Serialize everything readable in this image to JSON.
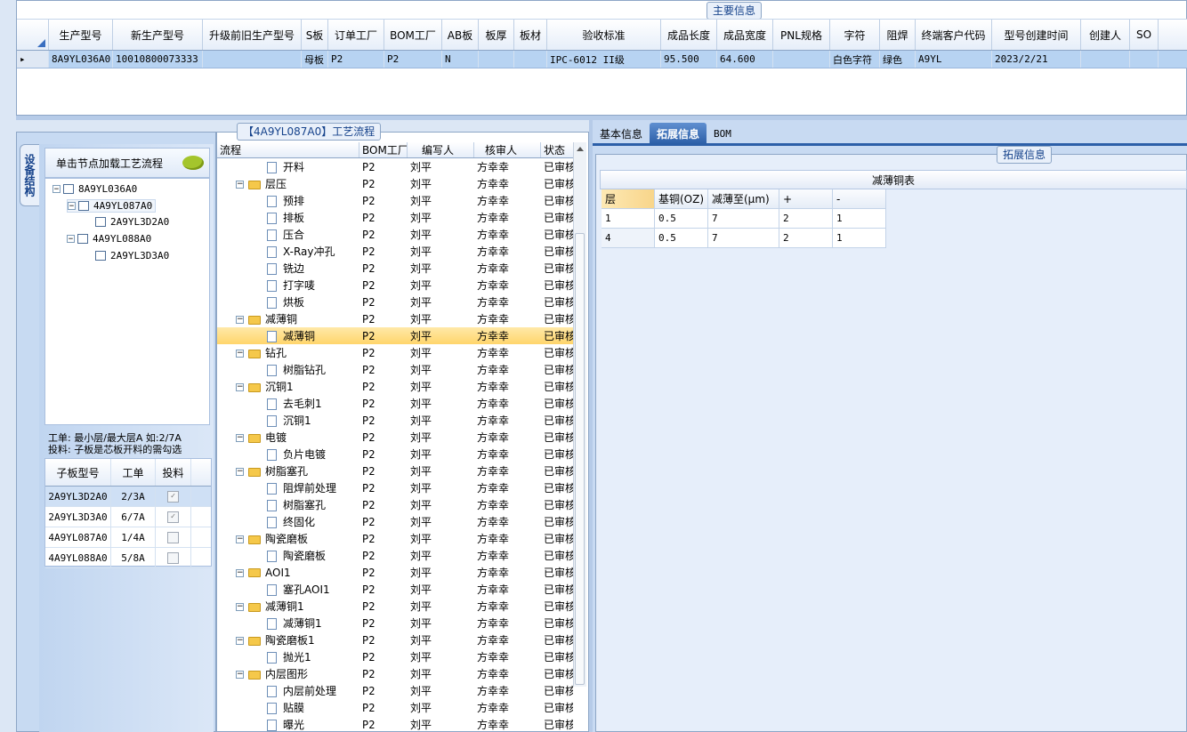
{
  "main_group_title": "主要信息",
  "main_grid": {
    "columns": [
      "生产型号",
      "新生产型号",
      "升级前旧生产型号",
      "S板",
      "订单工厂",
      "BOM工厂",
      "AB板",
      "板厚",
      "板材",
      "验收标准",
      "成品长度",
      "成品宽度",
      "PNL规格",
      "字符",
      "阻焊",
      "终端客户代码",
      "型号创建时间",
      "创建人",
      "SO"
    ],
    "row": [
      "8A9YL036A0",
      "10010800073333",
      "",
      "母板",
      "P2",
      "P2",
      "N",
      "",
      "",
      "IPC-6012 II级",
      "95.500",
      "64.600",
      "",
      "白色字符",
      "绿色",
      "A9YL",
      "2023/2/21",
      "",
      ""
    ]
  },
  "side_tab_label": "设备结构",
  "hint_text": "单击节点加载工艺流程",
  "tree": [
    {
      "label": "8A9YL036A0",
      "level": 0
    },
    {
      "label": "4A9YL087A0",
      "level": 1
    },
    {
      "label": "2A9YL3D2A0",
      "level": 2
    },
    {
      "label": "4A9YL088A0",
      "level": 1
    },
    {
      "label": "2A9YL3D3A0",
      "level": 2
    }
  ],
  "notes": {
    "line1": "工单: 最小层/最大层A 如:2/7A",
    "line2": "投料: 子板是芯板开料的需勾选"
  },
  "sub_grid": {
    "headers": [
      "子板型号",
      "工单",
      "投料"
    ],
    "rows": [
      {
        "model": "2A9YL3D2A0",
        "order": "2/3A",
        "checked": true
      },
      {
        "model": "2A9YL3D3A0",
        "order": "6/7A",
        "checked": true
      },
      {
        "model": "4A9YL087A0",
        "order": "1/4A",
        "checked": false
      },
      {
        "model": "4A9YL088A0",
        "order": "5/8A",
        "checked": false
      }
    ]
  },
  "process_title": "【4A9YL087A0】工艺流程",
  "process_headers": [
    "流程",
    "BOM工厂",
    "编写人",
    "核审人",
    "状态"
  ],
  "process_rows": [
    {
      "name": "开料",
      "type": "doc",
      "bom": "P2",
      "writer": "刘平",
      "reviewer": "方幸幸",
      "status": "已审核"
    },
    {
      "name": "层压",
      "type": "folder",
      "bom": "P2",
      "writer": "刘平",
      "reviewer": "方幸幸",
      "status": "已审核"
    },
    {
      "name": "预排",
      "type": "doc",
      "bom": "P2",
      "writer": "刘平",
      "reviewer": "方幸幸",
      "status": "已审核"
    },
    {
      "name": "排板",
      "type": "doc",
      "bom": "P2",
      "writer": "刘平",
      "reviewer": "方幸幸",
      "status": "已审核"
    },
    {
      "name": "压合",
      "type": "doc",
      "bom": "P2",
      "writer": "刘平",
      "reviewer": "方幸幸",
      "status": "已审核"
    },
    {
      "name": "X-Ray冲孔",
      "type": "doc",
      "bom": "P2",
      "writer": "刘平",
      "reviewer": "方幸幸",
      "status": "已审核"
    },
    {
      "name": "铣边",
      "type": "doc",
      "bom": "P2",
      "writer": "刘平",
      "reviewer": "方幸幸",
      "status": "已审核"
    },
    {
      "name": "打字唛",
      "type": "doc",
      "bom": "P2",
      "writer": "刘平",
      "reviewer": "方幸幸",
      "status": "已审核"
    },
    {
      "name": "烘板",
      "type": "doc",
      "bom": "P2",
      "writer": "刘平",
      "reviewer": "方幸幸",
      "status": "已审核"
    },
    {
      "name": "减薄铜",
      "type": "folder",
      "bom": "P2",
      "writer": "刘平",
      "reviewer": "方幸幸",
      "status": "已审核"
    },
    {
      "name": "减薄铜",
      "type": "doc",
      "bom": "P2",
      "writer": "刘平",
      "reviewer": "方幸幸",
      "status": "已审核",
      "selected": true
    },
    {
      "name": "钻孔",
      "type": "folder",
      "bom": "P2",
      "writer": "刘平",
      "reviewer": "方幸幸",
      "status": "已审核"
    },
    {
      "name": "树脂钻孔",
      "type": "doc",
      "bom": "P2",
      "writer": "刘平",
      "reviewer": "方幸幸",
      "status": "已审核"
    },
    {
      "name": "沉铜1",
      "type": "folder",
      "bom": "P2",
      "writer": "刘平",
      "reviewer": "方幸幸",
      "status": "已审核"
    },
    {
      "name": "去毛刺1",
      "type": "doc",
      "bom": "P2",
      "writer": "刘平",
      "reviewer": "方幸幸",
      "status": "已审核"
    },
    {
      "name": "沉铜1",
      "type": "doc",
      "bom": "P2",
      "writer": "刘平",
      "reviewer": "方幸幸",
      "status": "已审核"
    },
    {
      "name": "电镀",
      "type": "folder",
      "bom": "P2",
      "writer": "刘平",
      "reviewer": "方幸幸",
      "status": "已审核"
    },
    {
      "name": "负片电镀",
      "type": "doc",
      "bom": "P2",
      "writer": "刘平",
      "reviewer": "方幸幸",
      "status": "已审核"
    },
    {
      "name": "树脂塞孔",
      "type": "folder",
      "bom": "P2",
      "writer": "刘平",
      "reviewer": "方幸幸",
      "status": "已审核"
    },
    {
      "name": "阻焊前处理",
      "type": "doc",
      "bom": "P2",
      "writer": "刘平",
      "reviewer": "方幸幸",
      "status": "已审核"
    },
    {
      "name": "树脂塞孔",
      "type": "doc",
      "bom": "P2",
      "writer": "刘平",
      "reviewer": "方幸幸",
      "status": "已审核"
    },
    {
      "name": "终固化",
      "type": "doc",
      "bom": "P2",
      "writer": "刘平",
      "reviewer": "方幸幸",
      "status": "已审核"
    },
    {
      "name": "陶瓷磨板",
      "type": "folder",
      "bom": "P2",
      "writer": "刘平",
      "reviewer": "方幸幸",
      "status": "已审核"
    },
    {
      "name": "陶瓷磨板",
      "type": "doc",
      "bom": "P2",
      "writer": "刘平",
      "reviewer": "方幸幸",
      "status": "已审核"
    },
    {
      "name": "AOI1",
      "type": "folder",
      "bom": "P2",
      "writer": "刘平",
      "reviewer": "方幸幸",
      "status": "已审核"
    },
    {
      "name": "塞孔AOI1",
      "type": "doc",
      "bom": "P2",
      "writer": "刘平",
      "reviewer": "方幸幸",
      "status": "已审核"
    },
    {
      "name": "减薄铜1",
      "type": "folder",
      "bom": "P2",
      "writer": "刘平",
      "reviewer": "方幸幸",
      "status": "已审核"
    },
    {
      "name": "减薄铜1",
      "type": "doc",
      "bom": "P2",
      "writer": "刘平",
      "reviewer": "方幸幸",
      "status": "已审核"
    },
    {
      "name": "陶瓷磨板1",
      "type": "folder",
      "bom": "P2",
      "writer": "刘平",
      "reviewer": "方幸幸",
      "status": "已审核"
    },
    {
      "name": "抛光1",
      "type": "doc",
      "bom": "P2",
      "writer": "刘平",
      "reviewer": "方幸幸",
      "status": "已审核"
    },
    {
      "name": "内层图形",
      "type": "folder",
      "bom": "P2",
      "writer": "刘平",
      "reviewer": "方幸幸",
      "status": "已审核"
    },
    {
      "name": "内层前处理",
      "type": "doc",
      "bom": "P2",
      "writer": "刘平",
      "reviewer": "方幸幸",
      "status": "已审核"
    },
    {
      "name": "贴膜",
      "type": "doc",
      "bom": "P2",
      "writer": "刘平",
      "reviewer": "方幸幸",
      "status": "已审核"
    },
    {
      "name": "曝光",
      "type": "doc",
      "bom": "P2",
      "writer": "刘平",
      "reviewer": "方幸幸",
      "status": "已审核"
    }
  ],
  "tabs": [
    {
      "label": "基本信息",
      "active": false
    },
    {
      "label": "拓展信息",
      "active": true
    },
    {
      "label": "BOM",
      "active": false
    }
  ],
  "ext_group_title": "拓展信息",
  "copper_table": {
    "title": "减薄铜表",
    "headers": [
      "层",
      "基铜(OZ)",
      "减薄至(μm)",
      "+",
      "-"
    ],
    "rows": [
      [
        "1",
        "0.5",
        "7",
        "2",
        "1"
      ],
      [
        "4",
        "0.5",
        "7",
        "2",
        "1"
      ]
    ]
  },
  "colors": {
    "accent": "#2c5fa8",
    "selection": "#ffd56b",
    "panel": "#c8daf2"
  }
}
